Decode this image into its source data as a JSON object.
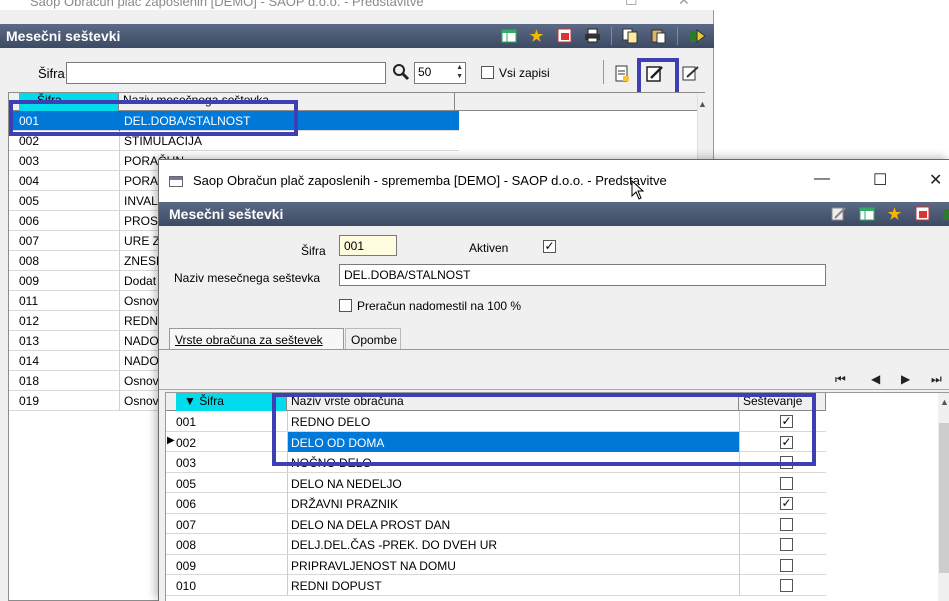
{
  "back_window": {
    "title": "Saop Obračun plač zaposlenih [DEMO] - SAOP d.o.o. - Predstavitve",
    "header": "Mesečni seštevki",
    "toolbar_icons": [
      "table-icon",
      "star-icon",
      "export-red-icon",
      "print-icon",
      "copy-icon",
      "paste-icon",
      "exit-green-icon"
    ],
    "search": {
      "label": "Šifra",
      "value": "",
      "count": "50",
      "all_records_label": "Vsi zapisi",
      "action_icons": [
        "new-record-icon",
        "edit-record-icon",
        "edit-alt-icon"
      ]
    },
    "grid": {
      "columns": [
        "Šifra",
        "Naziv mesečnega seštevka"
      ],
      "rows": [
        {
          "code": "001",
          "name": "DEL.DOBA/STALNOST"
        },
        {
          "code": "002",
          "name": "STIMULACIJA"
        },
        {
          "code": "003",
          "name": "PORAČUN"
        },
        {
          "code": "004",
          "name": "PORAČ"
        },
        {
          "code": "005",
          "name": "INVALI"
        },
        {
          "code": "006",
          "name": "PROST"
        },
        {
          "code": "007",
          "name": "URE Z"
        },
        {
          "code": "008",
          "name": "ZNESK"
        },
        {
          "code": "009",
          "name": "Dodat"
        },
        {
          "code": "011",
          "name": "Osnov"
        },
        {
          "code": "012",
          "name": "REDNO"
        },
        {
          "code": "013",
          "name": "NADO"
        },
        {
          "code": "014",
          "name": "NADO"
        },
        {
          "code": "018",
          "name": "Osnov"
        },
        {
          "code": "019",
          "name": "Osnov"
        }
      ],
      "selected_index": 0
    }
  },
  "front_window": {
    "title": "Saop Obračun plač zaposlenih - sprememba [DEMO] - SAOP d.o.o. - Predstavitve",
    "controls": {
      "minimize": "—",
      "maximize": "☐",
      "close": "✕"
    },
    "header": "Mesečni seštevki",
    "toolbar_icons": [
      "edit-icon",
      "table-icon",
      "star-icon",
      "export-red-icon",
      "exit-green-icon"
    ],
    "form": {
      "code_label": "Šifra",
      "code_value": "001",
      "active_label": "Aktiven",
      "active_checked": true,
      "name_label": "Naziv mesečnega seštevka",
      "name_value": "DEL.DOBA/STALNOST",
      "recalc_label": "Preračun nadomestil na 100 %",
      "recalc_checked": false
    },
    "tabs": [
      {
        "label": "Vrste obračuna za seštevek",
        "active": true
      },
      {
        "label": "Opombe",
        "active": false
      }
    ],
    "nav": [
      "⏮",
      "◀",
      "▶",
      "⏭"
    ],
    "grid": {
      "columns": [
        "Šifra",
        "Naziv vrste obračuna",
        "Seštevanje"
      ],
      "rows": [
        {
          "code": "001",
          "name": "REDNO DELO",
          "sum": true
        },
        {
          "code": "002",
          "name": "DELO OD DOMA",
          "sum": true
        },
        {
          "code": "003",
          "name": "NOČNO DELO",
          "sum": false
        },
        {
          "code": "005",
          "name": "DELO NA NEDELJO",
          "sum": false
        },
        {
          "code": "006",
          "name": "DRŽAVNI PRAZNIK",
          "sum": true
        },
        {
          "code": "007",
          "name": "DELO NA DELA PROST DAN",
          "sum": false
        },
        {
          "code": "008",
          "name": "DELJ.DEL.ČAS -PREK. DO DVEH UR",
          "sum": false
        },
        {
          "code": "009",
          "name": "PRIPRAVLJENOST NA DOMU",
          "sum": false
        },
        {
          "code": "010",
          "name": "REDNI DOPUST",
          "sum": false
        }
      ],
      "selected_index": 1
    }
  },
  "colors": {
    "header_bar": "#4a5874",
    "selection": "#0078d7",
    "sort_column": "#00dcec",
    "highlight_box": "#3f3fb4"
  }
}
